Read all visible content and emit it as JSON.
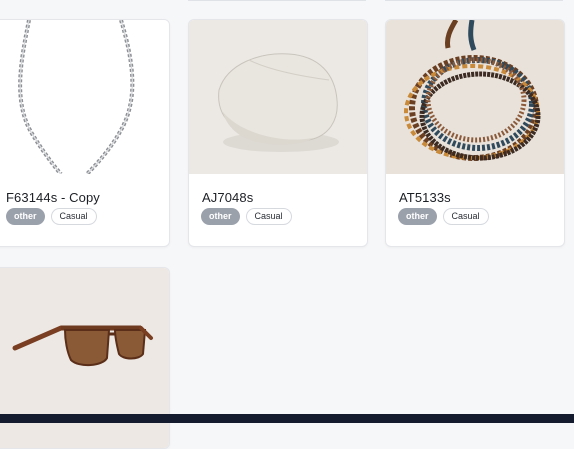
{
  "products": [
    {
      "title": "F63144s - Copy",
      "tags": [
        "other",
        "Casual"
      ],
      "image": "silver-chain-necklace"
    },
    {
      "title": "AJ7048s",
      "tags": [
        "other",
        "Casual"
      ],
      "image": "linen-flat-cap"
    },
    {
      "title": "AT5133s",
      "tags": [
        "other",
        "Casual"
      ],
      "image": "beaded-wrap-bracelet"
    },
    {
      "title": "",
      "tags": [],
      "image": "tortoise-sunglasses"
    }
  ],
  "colors": {
    "page_background": "#f6f7f9",
    "tag_primary": "#9aa1ab",
    "bottom_bar": "#151b2e"
  }
}
